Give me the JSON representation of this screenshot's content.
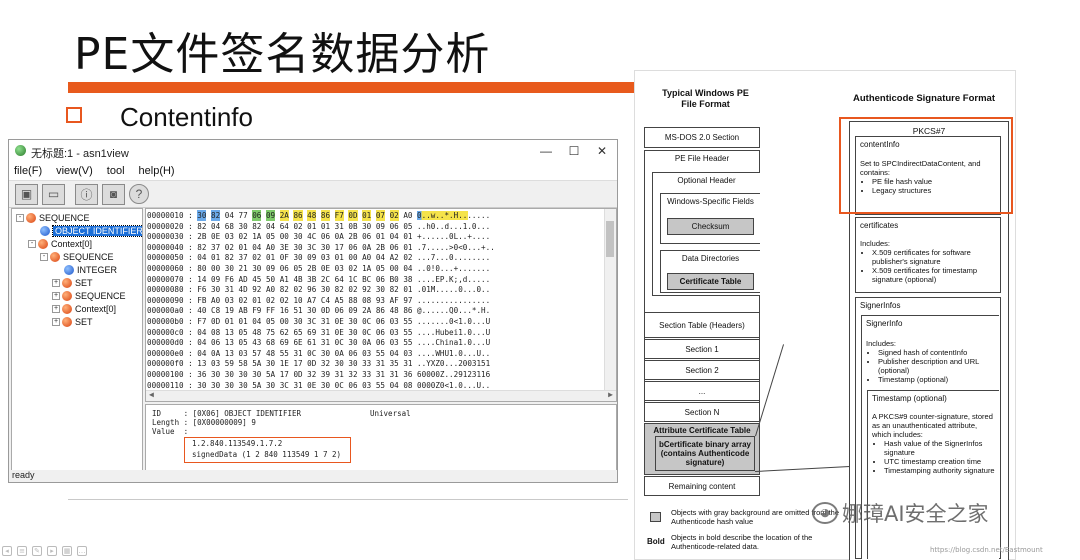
{
  "slide": {
    "title": "PE文件签名数据分析",
    "bullet": "Contentinfo"
  },
  "window": {
    "title": "无标题:1 - asn1view",
    "menu": [
      "file(F)",
      "view(V)",
      "tool",
      "help(H)"
    ],
    "controls": {
      "minimize": "—",
      "maximize": "☐",
      "close": "✕"
    },
    "toolbar_icons": [
      "open-file-icon",
      "folder-icon",
      "info-icon",
      "save-icon",
      "help-icon"
    ],
    "status": "ready"
  },
  "tree": [
    {
      "label": "SEQUENCE",
      "icon": "red",
      "level": 0,
      "expander": "-"
    },
    {
      "label": "OBJECT IDENTIFIER",
      "icon": "blue",
      "level": 1,
      "expander": "",
      "selected": true
    },
    {
      "label": "Context[0]",
      "icon": "red",
      "level": 1,
      "expander": "-"
    },
    {
      "label": "SEQUENCE",
      "icon": "red",
      "level": 2,
      "expander": "-"
    },
    {
      "label": "INTEGER",
      "icon": "blue",
      "level": 3,
      "expander": ""
    },
    {
      "label": "SET",
      "icon": "red",
      "level": 3,
      "expander": "+"
    },
    {
      "label": "SEQUENCE",
      "icon": "red",
      "level": 3,
      "expander": "+"
    },
    {
      "label": "Context[0]",
      "icon": "red",
      "level": 3,
      "expander": "+"
    },
    {
      "label": "SET",
      "icon": "red",
      "level": 3,
      "expander": "+"
    }
  ],
  "hex_rows": [
    {
      "addr": "00000010 :",
      "bytes": [
        "30",
        "82",
        "04",
        "77",
        "06",
        "09",
        "2A",
        "86",
        "48",
        "86",
        "F7",
        "0D",
        "01",
        "07",
        "02",
        "A0"
      ],
      "ascii": "0..w..*.H......."
    },
    {
      "addr": "00000020 :",
      "bytes": [
        "82",
        "04",
        "68",
        "30",
        "82",
        "04",
        "64",
        "02",
        "01",
        "01",
        "31",
        "0B",
        "30",
        "09",
        "06",
        "05"
      ],
      "ascii": "..h0..d...1.0..."
    },
    {
      "addr": "00000030 :",
      "bytes": [
        "2B",
        "0E",
        "03",
        "02",
        "1A",
        "05",
        "00",
        "30",
        "4C",
        "06",
        "0A",
        "2B",
        "06",
        "01",
        "04",
        "01"
      ],
      "ascii": "+......0L..+...."
    },
    {
      "addr": "00000040 :",
      "bytes": [
        "82",
        "37",
        "02",
        "01",
        "04",
        "A0",
        "3E",
        "30",
        "3C",
        "30",
        "17",
        "06",
        "0A",
        "2B",
        "06",
        "01"
      ],
      "ascii": ".7.....>0<0...+.."
    },
    {
      "addr": "00000050 :",
      "bytes": [
        "04",
        "01",
        "82",
        "37",
        "02",
        "01",
        "0F",
        "30",
        "09",
        "03",
        "01",
        "00",
        "A0",
        "04",
        "A2",
        "02"
      ],
      "ascii": "...7...0........"
    },
    {
      "addr": "00000060 :",
      "bytes": [
        "80",
        "00",
        "30",
        "21",
        "30",
        "09",
        "06",
        "05",
        "2B",
        "0E",
        "03",
        "02",
        "1A",
        "05",
        "00",
        "04"
      ],
      "ascii": "..0!0...+......."
    },
    {
      "addr": "00000070 :",
      "bytes": [
        "14",
        "09",
        "F6",
        "AD",
        "45",
        "50",
        "A1",
        "4B",
        "3B",
        "2C",
        "64",
        "1C",
        "BC",
        "06",
        "B0",
        "38"
      ],
      "ascii": "....EP.K;,d....."
    },
    {
      "addr": "00000080 :",
      "bytes": [
        "F6",
        "30",
        "31",
        "4D",
        "92",
        "A0",
        "82",
        "02",
        "96",
        "30",
        "82",
        "02",
        "92",
        "30",
        "82",
        "01"
      ],
      "ascii": ".01M.....0...0.."
    },
    {
      "addr": "00000090 :",
      "bytes": [
        "FB",
        "A0",
        "03",
        "02",
        "01",
        "02",
        "02",
        "10",
        "A7",
        "C4",
        "A5",
        "88",
        "08",
        "93",
        "AF",
        "97"
      ],
      "ascii": "................"
    },
    {
      "addr": "000000a0 :",
      "bytes": [
        "40",
        "C8",
        "19",
        "AB",
        "F9",
        "FF",
        "16",
        "51",
        "30",
        "0D",
        "06",
        "09",
        "2A",
        "86",
        "48",
        "86"
      ],
      "ascii": "@......Q0...*.H."
    },
    {
      "addr": "000000b0 :",
      "bytes": [
        "F7",
        "0D",
        "01",
        "01",
        "04",
        "05",
        "00",
        "30",
        "3C",
        "31",
        "0E",
        "30",
        "0C",
        "06",
        "03",
        "55"
      ],
      "ascii": ".......0<1.0...U"
    },
    {
      "addr": "000000c0 :",
      "bytes": [
        "04",
        "08",
        "13",
        "05",
        "48",
        "75",
        "62",
        "65",
        "69",
        "31",
        "0E",
        "30",
        "0C",
        "06",
        "03",
        "55"
      ],
      "ascii": "....Hubei1.0...U"
    },
    {
      "addr": "000000d0 :",
      "bytes": [
        "04",
        "06",
        "13",
        "05",
        "43",
        "68",
        "69",
        "6E",
        "61",
        "31",
        "0C",
        "30",
        "0A",
        "06",
        "03",
        "55"
      ],
      "ascii": "....China1.0...U"
    },
    {
      "addr": "000000e0 :",
      "bytes": [
        "04",
        "0A",
        "13",
        "03",
        "57",
        "48",
        "55",
        "31",
        "0C",
        "30",
        "0A",
        "06",
        "03",
        "55",
        "04",
        "03"
      ],
      "ascii": "....WHU1.0...U.."
    },
    {
      "addr": "000000f0 :",
      "bytes": [
        "13",
        "03",
        "59",
        "58",
        "5A",
        "30",
        "1E",
        "17",
        "0D",
        "32",
        "30",
        "30",
        "33",
        "31",
        "35",
        "31"
      ],
      "ascii": "..YXZ0...2003151"
    },
    {
      "addr": "00000100 :",
      "bytes": [
        "36",
        "30",
        "30",
        "30",
        "30",
        "5A",
        "17",
        "0D",
        "32",
        "39",
        "31",
        "32",
        "33",
        "31",
        "31",
        "36"
      ],
      "ascii": "60000Z..29123116"
    },
    {
      "addr": "00000110 :",
      "bytes": [
        "30",
        "30",
        "30",
        "30",
        "5A",
        "30",
        "3C",
        "31",
        "0E",
        "30",
        "0C",
        "06",
        "03",
        "55",
        "04",
        "08"
      ],
      "ascii": "0000Z0<1.0...U.."
    }
  ],
  "hex_highlight": {
    "blue": [
      0,
      1
    ],
    "green": [
      4,
      5
    ],
    "yellow": [
      6,
      7,
      8,
      9,
      10,
      11,
      12,
      13,
      14
    ],
    "ascii_blue": [
      0
    ]
  },
  "info": {
    "id_line": "ID     : [0X06] OBJECT IDENTIFIER",
    "id_class": "Universal",
    "length_line": "Length : [0X00000009] 9",
    "value_label": "Value  :",
    "value_1": "1.2.840.113549.1.7.2",
    "value_2": "signedData (1 2 840 113549 1 7 2)"
  },
  "diagram": {
    "left_title": "Typical Windows PE\nFile Format",
    "right_title": "Authenticode Signature Format",
    "pe_boxes": {
      "msdos": "MS-DOS 2.0 Section",
      "pe_header": "PE File Header",
      "optional_header": "Optional Header",
      "windows_fields": "Windows-Specific Fields",
      "checksum": "Checksum",
      "data_dirs": "Data Directories",
      "cert_table": "Certificate Table",
      "section_table": "Section Table (Headers)",
      "section1": "Section 1",
      "section2": "Section 2",
      "ellipsis": "...",
      "sectionN": "Section N",
      "attr_cert": "Attribute Certificate Table",
      "bcert": "bCertificate binary array\n(contains Authenticode\nsignature)",
      "remaining": "Remaining content"
    },
    "pkcs": {
      "title": "PKCS#7",
      "contentinfo_title": "contentInfo",
      "contentinfo_desc": "Set to SPCIndirectDataContent, and contains:",
      "contentinfo_items": [
        "PE file hash value",
        "Legacy structures"
      ],
      "certs_title": "certificates",
      "certs_desc": "Includes:",
      "certs_items": [
        "X.509 certificates for software publisher's signature",
        "X.509 certificates for timestamp signature (optional)"
      ],
      "signerinfos_title": "SignerInfos",
      "signerinfo_title": "SignerInfo",
      "signerinfo_desc": "Includes:",
      "signerinfo_items": [
        "Signed hash of contentInfo",
        "Publisher description and URL (optional)",
        "Timestamp (optional)"
      ],
      "timestamp_title": "Timestamp (optional)",
      "timestamp_desc": "A PKCS#9 counter-signature, stored as an unauthenticated attribute, which includes:",
      "timestamp_items": [
        "Hash value of the SignerInfos signature",
        "UTC timestamp creation time",
        "Timestamping authority signature"
      ]
    },
    "legend": {
      "gray_text": "Objects with gray background are omitted from the Authenticode hash value",
      "bold_label": "Bold",
      "bold_text": "Objects in bold describe the location of the Authenticode-related data."
    }
  },
  "watermark": "娜璋AI安全之家",
  "blog_url": "https://blog.csdn.net/Eastmount",
  "colors": {
    "accent": "#e85a1c",
    "selection": "#1c6fd8",
    "hex_blue": "#6aa9ea",
    "hex_green": "#7ecb6a",
    "hex_yellow": "#f5e34a"
  }
}
